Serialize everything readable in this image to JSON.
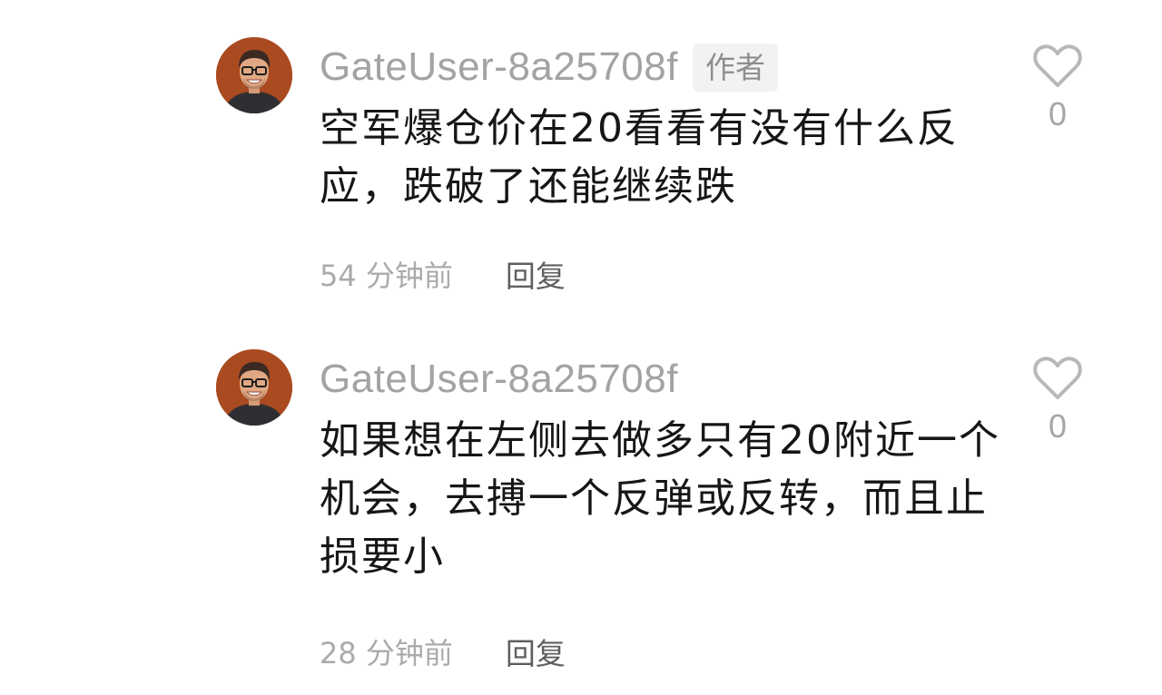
{
  "comments": [
    {
      "username": "GateUser-8a25708f",
      "author_badge": "作者",
      "text": "空军爆仓价在20看看有没有什么反应，跌破了还能继续跌",
      "time": "54 分钟前",
      "reply_label": "回复",
      "like_count": "0",
      "icons": {
        "avatar": "avatar-icon",
        "like": "heart-icon"
      }
    },
    {
      "username": "GateUser-8a25708f",
      "text": "如果想在左侧去做多只有20附近一个机会，去搏一个反弹或反转，而且止损要小",
      "time": "28 分钟前",
      "reply_label": "回复",
      "like_count": "0",
      "icons": {
        "avatar": "avatar-icon",
        "like": "heart-icon"
      }
    }
  ],
  "colors": {
    "background": "#ffffff",
    "username": "#a3a3a3",
    "body_text": "#161616",
    "meta_text": "#ababab",
    "reply_text": "#5f5f5f",
    "badge_bg": "#f2f2f2",
    "avatar_bg": "#a94a20"
  }
}
